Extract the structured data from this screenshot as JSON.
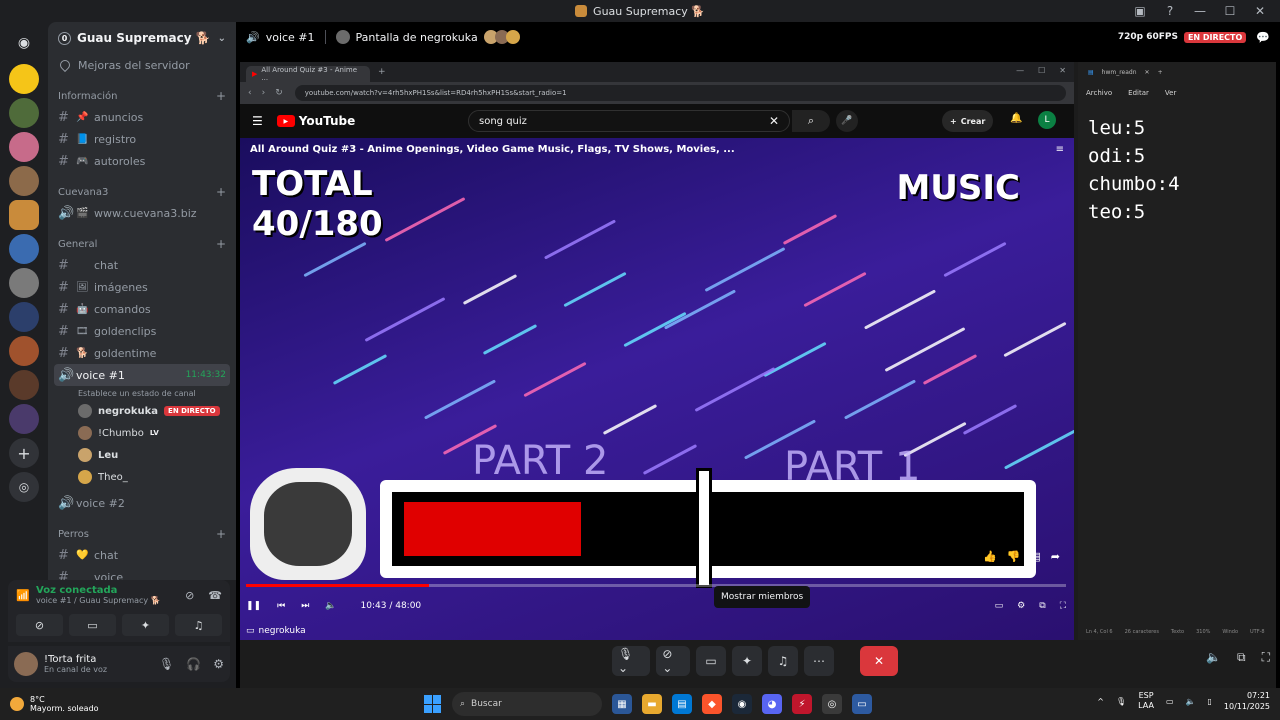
{
  "window": {
    "title": "Guau Supremacy 🐕",
    "controls": [
      "▣",
      "?",
      "—",
      "☐",
      "✕"
    ]
  },
  "server": {
    "name": "Guau Supremacy 🐕",
    "boost_level": "0",
    "improve_label": "Mejoras del servidor"
  },
  "sidebar": {
    "categories": [
      {
        "name": "Información",
        "channels": [
          {
            "icon": "#",
            "emoji": "📌",
            "name": "anuncios"
          },
          {
            "icon": "#",
            "emoji": "📘",
            "name": "registro"
          },
          {
            "icon": "#",
            "emoji": "🎮",
            "name": "autoroles"
          }
        ]
      },
      {
        "name": "Cuevana3",
        "channels": [
          {
            "icon": "🔊",
            "emoji": "🎬",
            "name": "www.cuevana3.biz"
          }
        ]
      },
      {
        "name": "General",
        "channels": [
          {
            "icon": "#",
            "emoji": "",
            "name": "chat"
          },
          {
            "icon": "#",
            "emoji": "🖼",
            "name": "imágenes"
          },
          {
            "icon": "#",
            "emoji": "🤖",
            "name": "comandos"
          },
          {
            "icon": "#",
            "emoji": "🎞",
            "name": "goldenclips"
          },
          {
            "icon": "#",
            "emoji": "🐕",
            "name": "goldentime"
          }
        ]
      }
    ],
    "active_voice": {
      "name": "voice #1",
      "time": "11:43:32",
      "status": "Establece un estado de canal",
      "members": [
        {
          "name": "negrokuka",
          "live": "EN DIRECTO"
        },
        {
          "name": "!Chumbo",
          "badge": "LV"
        },
        {
          "name": "Leu"
        },
        {
          "name": "Theo_"
        }
      ]
    },
    "voice2": "voice #2",
    "perros_category": "Perros",
    "perros_channels": [
      {
        "icon": "#",
        "emoji": "💛",
        "name": "chat"
      },
      {
        "icon": "#",
        "emoji": "",
        "name": "voice"
      }
    ]
  },
  "voice_panel": {
    "status": "Voz conectada",
    "location": "voice #1 / Guau Supremacy 🐕"
  },
  "user_panel": {
    "name": "!Torta frita",
    "status": "En canal de voz"
  },
  "call_header": {
    "channel": "voice #1",
    "screen_share": "Pantalla de negrokuka",
    "quality": "720p 60FPS",
    "live": "EN DIRECTO"
  },
  "browser": {
    "tab": "All Around Quiz #3 - Anime ...",
    "url": "youtube.com/watch?v=4rh5hxPH1Ss&list=RD4rh5hxPH1Ss&start_radio=1"
  },
  "youtube": {
    "logo": "YouTube",
    "search_value": "song quiz",
    "create": "Crear",
    "avatar": "L",
    "video_title": "All Around Quiz #3 - Anime Openings, Video Game Music, Flags, TV Shows, Movies, ...",
    "total_line1": "TOTAL",
    "total_line2": "40/180",
    "category": "MUSIC",
    "part2": "PART 2",
    "part1": "PART 1",
    "time": "10:43 / 48:00",
    "progress": 0.223,
    "bar_level": 0.28,
    "streamer_tag": "negrokuka"
  },
  "notepad": {
    "tab": "hwm_readn",
    "menu": [
      "Archivo",
      "Editar",
      "Ver"
    ],
    "lines": [
      "leu:5",
      "odi:5",
      "chumbo:4",
      "teo:5"
    ],
    "status": [
      "Ln 4, Col 6",
      "26 caracteres",
      "Texto",
      "310%",
      "Windo",
      "UTF-8"
    ]
  },
  "tooltip": "Mostrar miembros",
  "taskbar": {
    "temp": "8°C",
    "weather": "Mayorm. soleado",
    "search": "Buscar",
    "lang1": "ESP",
    "lang2": "LAA",
    "time": "07:21",
    "date": "10/11/2025"
  },
  "colors": {
    "accent_green": "#23a55a",
    "live_red": "#da373c",
    "yt_red": "#ff0000"
  }
}
